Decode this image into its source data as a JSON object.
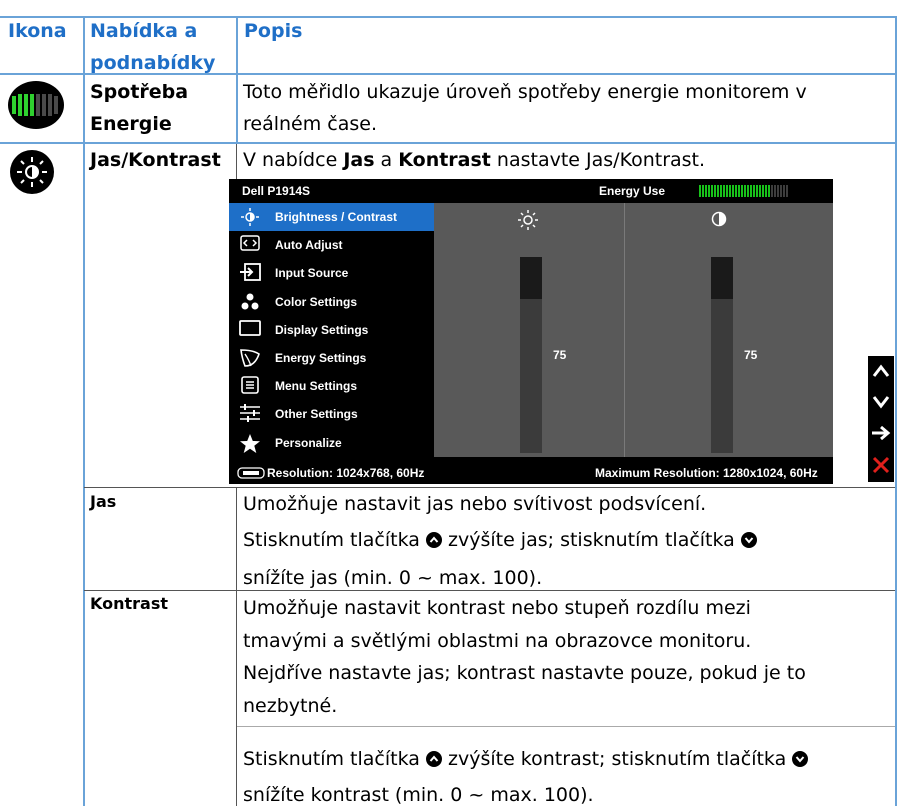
{
  "table": {
    "headers": [
      "Ikona",
      "Nabídka a podnabídky",
      "Popis"
    ],
    "header_nabidka_line1": "Nabídka a",
    "header_nabidka_line2": "podnabídky",
    "rows": {
      "energy": {
        "icon": "energy-meter-icon",
        "label_line1": "Spotřeba",
        "label_line2": "Energie",
        "desc_line1": "Toto měřidlo ukazuje úroveň spotřeby energie monitorem v",
        "desc_line2": "reálném čase."
      },
      "brightness": {
        "icon": "sun-icon",
        "label": "Jas/Kontrast",
        "desc_prefix": "V nabídce ",
        "desc_bold1": "Jas",
        "desc_mid": " a ",
        "desc_bold2": "Kontrast",
        "desc_suffix": " nastavte Jas/Kontrast."
      },
      "jas": {
        "label": "Jas",
        "desc_line1": "Umožňuje nastavit jas nebo svítivost podsvícení.",
        "desc_line2a": "Stisknutím tlačítka ",
        "desc_line2b": " zvýšíte jas; stisknutím tlačítka ",
        "desc_line3": "snížíte jas (min. 0 ~ max. 100)."
      },
      "kontrast": {
        "label": "Kontrast",
        "desc_line1": "Umožňuje nastavit kontrast nebo stupeň rozdílu mezi",
        "desc_line2": "tmavými a světlými oblastmi na obrazovce monitoru.",
        "desc_line3": "Nejdříve nastavte jas; kontrast nastavte pouze, pokud je to",
        "desc_line4": "nezbytné.",
        "desc_line5a": "Stisknutím tlačítka ",
        "desc_line5b": " zvýšíte kontrast; stisknutím tlačítka ",
        "desc_line6": "snížíte kontrast (min. 0 ~ max. 100)."
      }
    }
  },
  "osd": {
    "model": "Dell P1914S",
    "energy_label": "Energy Use",
    "energy_level": 0.8,
    "menu_items": [
      {
        "label": "Brightness / Contrast",
        "icon": "sun-icon"
      },
      {
        "label": "Auto Adjust",
        "icon": "auto-adjust-icon"
      },
      {
        "label": "Input Source",
        "icon": "input-source-icon"
      },
      {
        "label": "Color Settings",
        "icon": "color-dots-icon"
      },
      {
        "label": "Display Settings",
        "icon": "display-rect-icon"
      },
      {
        "label": "Energy Settings",
        "icon": "leaf-icon"
      },
      {
        "label": "Menu Settings",
        "icon": "menu-list-icon"
      },
      {
        "label": "Other Settings",
        "icon": "sliders-icon"
      },
      {
        "label": "Personalize",
        "icon": "star-icon"
      }
    ],
    "brightness_value": "75",
    "contrast_value": "75",
    "resolution": "Resolution: 1024x768,  60Hz",
    "max_resolution": "Maximum Resolution: 1280x1024,  60Hz"
  },
  "side_buttons": [
    "up-arrow-icon",
    "down-arrow-icon",
    "enter-arrow-icon",
    "close-x-icon"
  ],
  "colors": {
    "header_text": "#1f6fc7",
    "grid": "#6aa3d8",
    "osd_selected": "#1e6fc8",
    "energy_green": "#18c21a",
    "exit_red": "#e0201c"
  }
}
